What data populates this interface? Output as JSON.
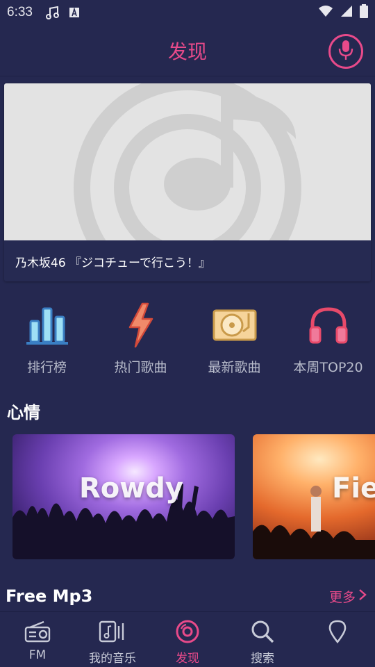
{
  "status_bar": {
    "time": "6:33",
    "icons": [
      "music-note-icon",
      "a-badge-icon",
      "wifi-icon",
      "signal-icon",
      "battery-icon"
    ]
  },
  "header": {
    "title": "发现",
    "mic_icon": "microphone-icon"
  },
  "banner": {
    "caption": "乃木坂46 『ジコチューで行こう！』",
    "placeholder_icon": "music-note-icon"
  },
  "categories": [
    {
      "label": "排行榜",
      "icon": "bar-chart-icon"
    },
    {
      "label": "热门歌曲",
      "icon": "lightning-icon"
    },
    {
      "label": "最新歌曲",
      "icon": "turntable-icon"
    },
    {
      "label": "本周TOP20",
      "icon": "headphones-icon"
    }
  ],
  "mood": {
    "title": "心情",
    "cards": [
      {
        "label": "Rowdy"
      },
      {
        "label": "Fiev"
      }
    ]
  },
  "free_mp3": {
    "title": "Free Mp3",
    "more_label": "更多"
  },
  "bottom_nav": {
    "items": [
      {
        "label": "FM",
        "icon": "radio-icon",
        "active": false
      },
      {
        "label": "我的音乐",
        "icon": "music-library-icon",
        "active": false
      },
      {
        "label": "发现",
        "icon": "disc-icon",
        "active": true
      },
      {
        "label": "搜索",
        "icon": "search-icon",
        "active": false
      },
      {
        "label": "",
        "icon": "location-pin-icon",
        "active": false
      }
    ]
  },
  "colors": {
    "background": "#252850",
    "accent": "#e84a8a",
    "muted_text": "#b8bccb"
  }
}
